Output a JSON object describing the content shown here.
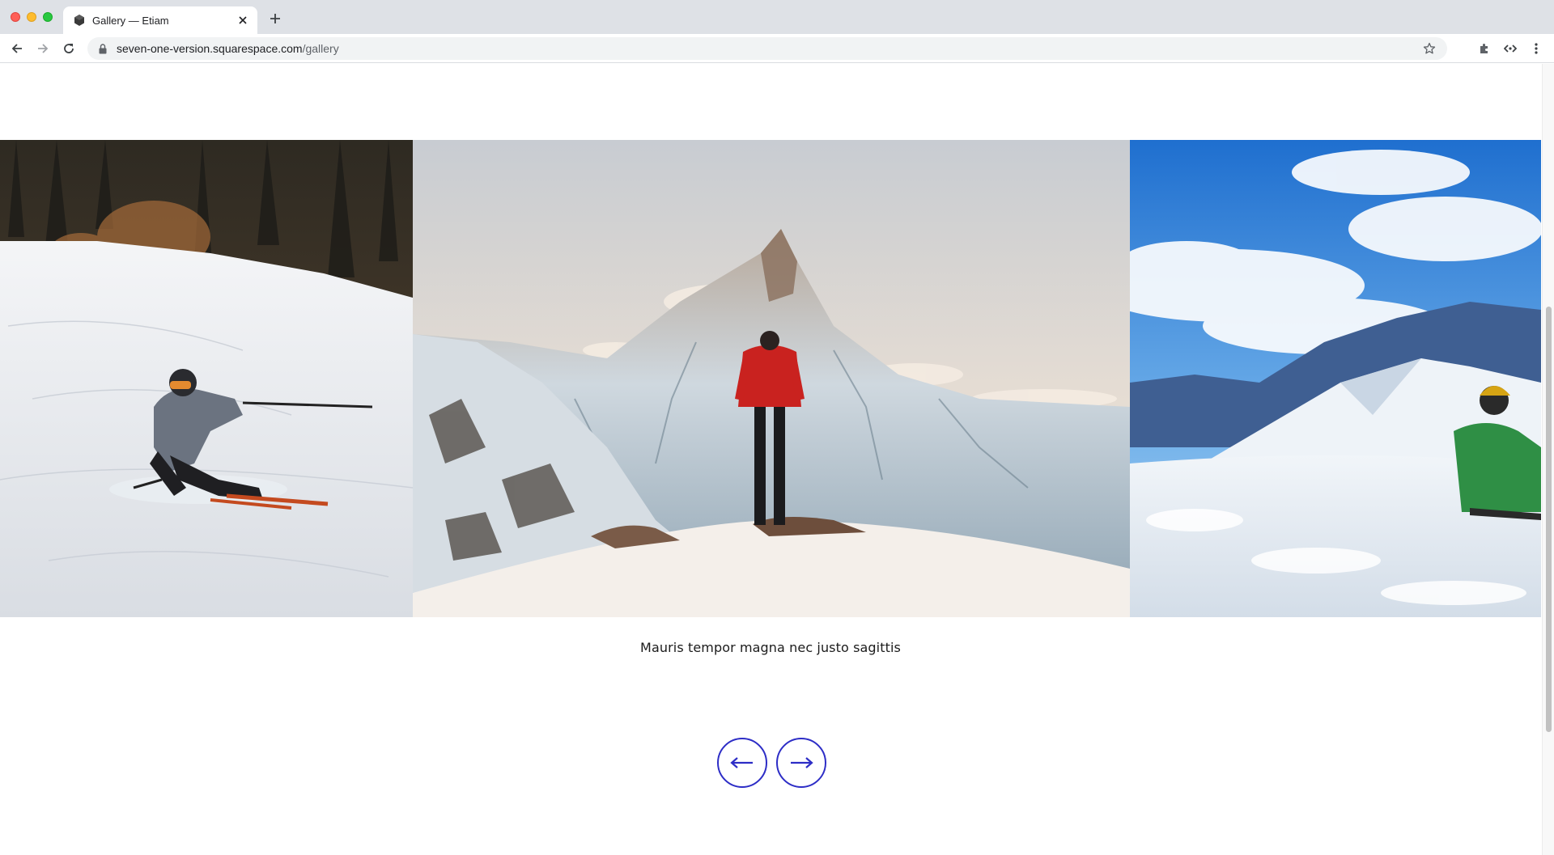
{
  "browser": {
    "tab_title": "Gallery — Etiam",
    "url_domain": "seven-one-version.squarespace.com",
    "url_path": "/gallery"
  },
  "gallery": {
    "slides": [
      {
        "alt": "skier carving on groomed slope"
      },
      {
        "alt": "hiker in red jacket facing Matterhorn"
      },
      {
        "alt": "snowboarder sitting in snow above clouds"
      }
    ],
    "caption": "Mauris tempor magna nec justo sagittis"
  },
  "colors": {
    "accent": "#2d2dc6",
    "tab_bar": "#dee1e6"
  },
  "icons": {
    "back": "arrow-left-icon",
    "forward": "arrow-right-icon",
    "reload": "reload-icon",
    "lock": "lock-icon",
    "bookmark": "star-icon",
    "extensions": "puzzle-icon",
    "menu": "kebab-menu-icon",
    "prev_slide": "arrow-left-icon",
    "next_slide": "arrow-right-icon"
  }
}
